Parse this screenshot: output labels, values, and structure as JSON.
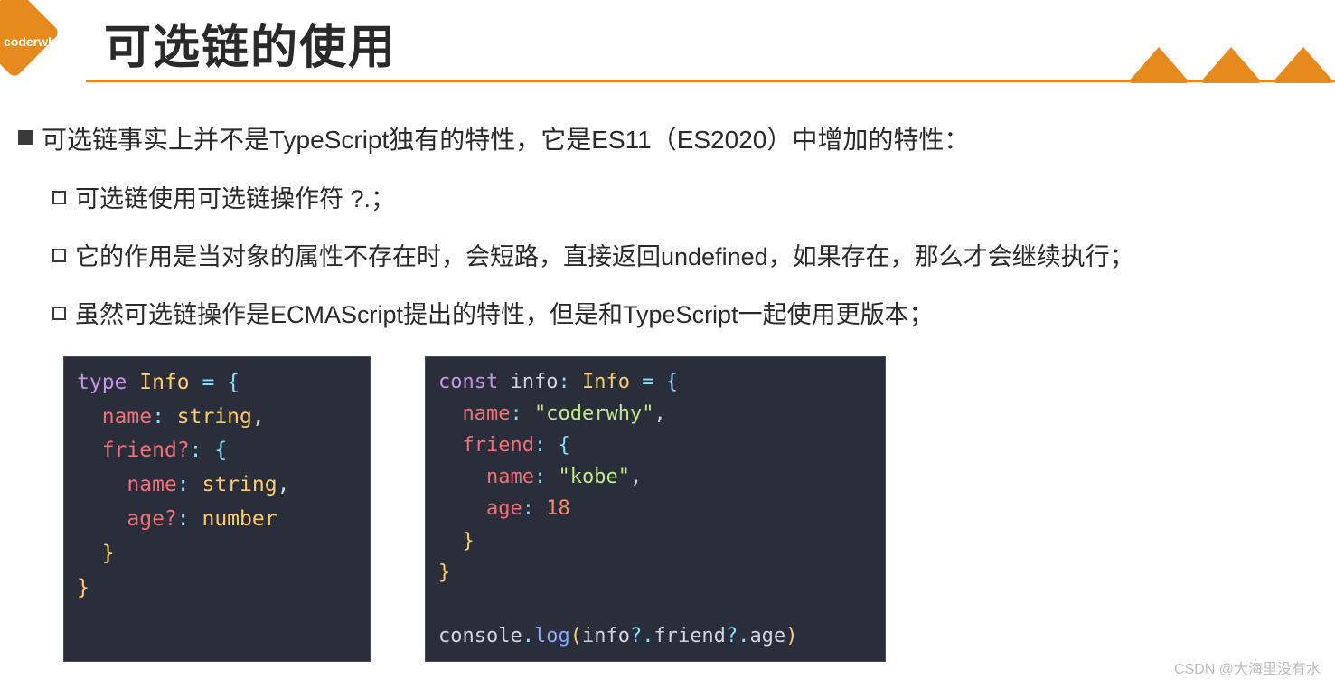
{
  "logo": {
    "text": "coderwhy"
  },
  "title": "可选链的使用",
  "bullets": {
    "main": "可选链事实上并不是TypeScript独有的特性，它是ES11（ES2020）中增加的特性：",
    "sub1": "可选链使用可选链操作符 ?.；",
    "sub2": "它的作用是当对象的属性不存在时，会短路，直接返回undefined，如果存在，那么才会继续执行；",
    "sub3": "虽然可选链操作是ECMAScript提出的特性，但是和TypeScript一起使用更版本；"
  },
  "code1": {
    "l1_kw": "type",
    "l1_name": "Info",
    "l1_eq": " = {",
    "l2_prop": "name",
    "l2_type": "string",
    "l2_end": ",",
    "l3_prop": "friend?",
    "l3_end": ": {",
    "l4_prop": "name",
    "l4_type": "string",
    "l4_end": ",",
    "l5_prop": "age?",
    "l5_type": "number",
    "l6": "}",
    "l7": "}"
  },
  "code2": {
    "l1_kw": "const",
    "l1_name": "info",
    "l1_colon": ": ",
    "l1_type": "Info",
    "l1_eq": " = {",
    "l2_prop": "name",
    "l2_val": "\"coderwhy\"",
    "l2_end": ",",
    "l3_prop": "friend",
    "l3_end": ": {",
    "l4_prop": "name",
    "l4_val": "\"kobe\"",
    "l4_end": ",",
    "l5_prop": "age",
    "l5_val": "18",
    "l6": "}",
    "l7": "}",
    "l8_obj": "console",
    "l8_dot1": ".",
    "l8_fn": "log",
    "l8_open": "(",
    "l8_a": "info",
    "l8_q1": "?.",
    "l8_b": "friend",
    "l8_q2": "?.",
    "l8_c": "age",
    "l8_close": ")"
  },
  "watermark": "CSDN @大海里没有水"
}
